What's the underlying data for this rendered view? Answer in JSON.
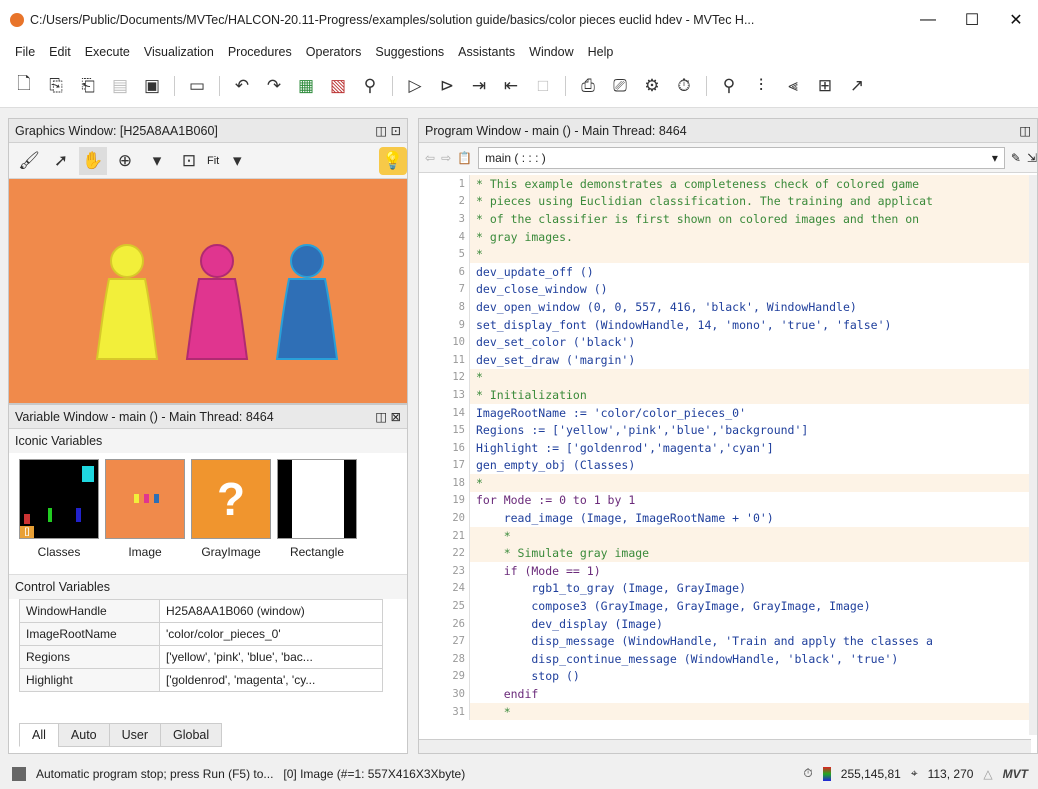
{
  "window": {
    "title": "C:/Users/Public/Documents/MVTec/HALCON-20.11-Progress/examples/solution guide/basics/color pieces euclid hdev - MVTec H...",
    "minimize": "—",
    "maximize": "☐",
    "close": "✕"
  },
  "menu": [
    "File",
    "Edit",
    "Execute",
    "Visualization",
    "Procedures",
    "Operators",
    "Suggestions",
    "Assistants",
    "Window",
    "Help"
  ],
  "graphics": {
    "title": "Graphics Window: [H25A8AA1B060]",
    "fit_label": "Fit"
  },
  "variables": {
    "title": "Variable Window - main () - Main Thread: 8464",
    "iconic_label": "Iconic Variables",
    "iconic": [
      "Classes",
      "Image",
      "GrayImage",
      "Rectangle"
    ],
    "control_label": "Control Variables",
    "control": [
      {
        "name": "WindowHandle",
        "value": "H25A8AA1B060 (window)"
      },
      {
        "name": "ImageRootName",
        "value": "'color/color_pieces_0'"
      },
      {
        "name": "Regions",
        "value": "['yellow', 'pink', 'blue', 'bac..."
      },
      {
        "name": "Highlight",
        "value": "['goldenrod', 'magenta', 'cy..."
      }
    ],
    "tabs": [
      "All",
      "Auto",
      "User",
      "Global"
    ]
  },
  "program": {
    "title": "Program Window - main () - Main Thread: 8464",
    "procedure": "main ( : : : )",
    "lines": [
      {
        "n": "1",
        "t": "* This example demonstrates a completeness check of colored game",
        "k": "comment"
      },
      {
        "n": "2",
        "t": "* pieces using Euclidian classification. The training and applicat",
        "k": "comment"
      },
      {
        "n": "3",
        "t": "* of the classifier is first shown on colored images and then on",
        "k": "comment"
      },
      {
        "n": "4",
        "t": "* gray images.",
        "k": "comment"
      },
      {
        "n": "5",
        "t": "*",
        "k": "comment"
      },
      {
        "n": "6",
        "t": "dev_update_off ()",
        "k": "op"
      },
      {
        "n": "7",
        "t": "dev_close_window ()",
        "k": "op"
      },
      {
        "n": "8",
        "t": "dev_open_window (0, 0, 557, 416, 'black', WindowHandle)",
        "k": "op"
      },
      {
        "n": "9",
        "t": "set_display_font (WindowHandle, 14, 'mono', 'true', 'false')",
        "k": "op"
      },
      {
        "n": "10",
        "t": "dev_set_color ('black')",
        "k": "op"
      },
      {
        "n": "11",
        "t": "dev_set_draw ('margin')",
        "k": "op"
      },
      {
        "n": "12",
        "t": "*",
        "k": "comment"
      },
      {
        "n": "13",
        "t": "* Initialization",
        "k": "comment"
      },
      {
        "n": "14",
        "t": "ImageRootName := 'color/color_pieces_0'",
        "k": "op"
      },
      {
        "n": "15",
        "t": "Regions := ['yellow','pink','blue','background']",
        "k": "op"
      },
      {
        "n": "16",
        "t": "Highlight := ['goldenrod','magenta','cyan']",
        "k": "op"
      },
      {
        "n": "17",
        "t": "gen_empty_obj (Classes)",
        "k": "op"
      },
      {
        "n": "18",
        "t": "*",
        "k": "comment"
      },
      {
        "n": "19",
        "t": "for Mode := 0 to 1 by 1",
        "k": "ctrl"
      },
      {
        "n": "20",
        "t": "    read_image (Image, ImageRootName + '0')",
        "k": "op"
      },
      {
        "n": "21",
        "t": "    *",
        "k": "comment"
      },
      {
        "n": "22",
        "t": "    * Simulate gray image",
        "k": "comment"
      },
      {
        "n": "23",
        "t": "    if (Mode == 1)",
        "k": "ctrl"
      },
      {
        "n": "24",
        "t": "        rgb1_to_gray (Image, GrayImage)",
        "k": "op"
      },
      {
        "n": "25",
        "t": "        compose3 (GrayImage, GrayImage, GrayImage, Image)",
        "k": "op"
      },
      {
        "n": "26",
        "t": "        dev_display (Image)",
        "k": "op"
      },
      {
        "n": "27",
        "t": "        disp_message (WindowHandle, 'Train and apply the classes a",
        "k": "op"
      },
      {
        "n": "28",
        "t": "        disp_continue_message (WindowHandle, 'black', 'true')",
        "k": "op"
      },
      {
        "n": "29",
        "t": "        stop ()",
        "k": "op"
      },
      {
        "n": "30",
        "t": "    endif",
        "k": "ctrl"
      },
      {
        "n": "31",
        "t": "    *",
        "k": "comment"
      }
    ]
  },
  "status": {
    "message": "Automatic program stop; press Run (F5) to...",
    "image_info": "[0] Image (#=1: 557X416X3Xbyte)",
    "rgb": "255,145,81",
    "coords": "113, 270"
  },
  "colors": {
    "canvas_bg": "#f08a4b",
    "yellow": "#f2ef3a",
    "pink": "#e0358f",
    "blue": "#2f6fb6"
  }
}
